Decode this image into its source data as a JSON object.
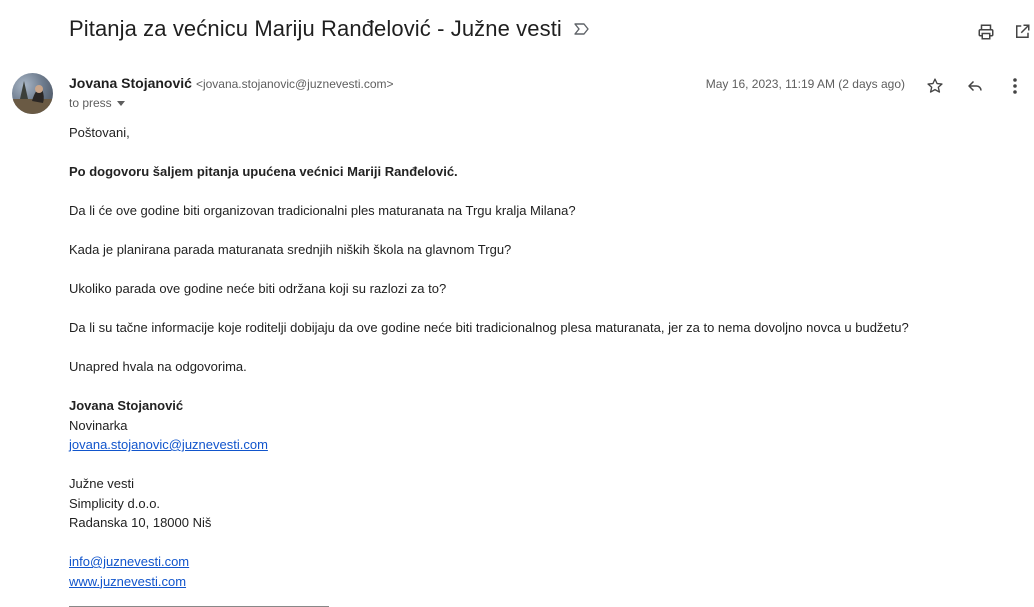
{
  "email": {
    "subject": "Pitanja za većnicu Mariju Ranđelović - Južne vesti",
    "sender_name": "Jovana Stojanović",
    "sender_email": "<jovana.stojanovic@juznevesti.com>",
    "to": "to press",
    "date": "May 16, 2023, 11:19 AM (2 days ago)"
  },
  "body": {
    "greeting": "Poštovani,",
    "intro": "Po dogovoru šaljem pitanja upućena većnici Mariji Ranđelović.",
    "q1": "Da li će ove godine biti organizovan tradicionalni ples maturanata na Trgu kralja Milana?",
    "q2": "Kada je planirana parada maturanata srednjih niških škola na glavnom Trgu?",
    "q3": "Ukoliko parada ove godine neće biti održana koji su razlozi za to?",
    "q4": "Da li su tačne informacije koje roditelji dobijaju da ove godine neće biti tradicionalnog plesa maturanata, jer za to nema dovoljno novca u budžetu?",
    "thanks": "Unapred hvala na odgovorima."
  },
  "signature": {
    "name": "Jovana Stojanović",
    "title": "Novinarka",
    "email": "jovana.stojanovic@juznevesti.com",
    "org": "Južne vesti",
    "company": "Simplicity d.o.o.",
    "address": "Radanska 10, 18000 Niš",
    "info_email": "info@juznevesti.com",
    "website": "www.juznevesti.com"
  },
  "icons": {
    "label": "label-important-icon",
    "print": "print-icon",
    "open_new_window": "open-in-new-icon",
    "star": "star-icon",
    "reply": "reply-icon",
    "more": "more-vert-icon"
  }
}
